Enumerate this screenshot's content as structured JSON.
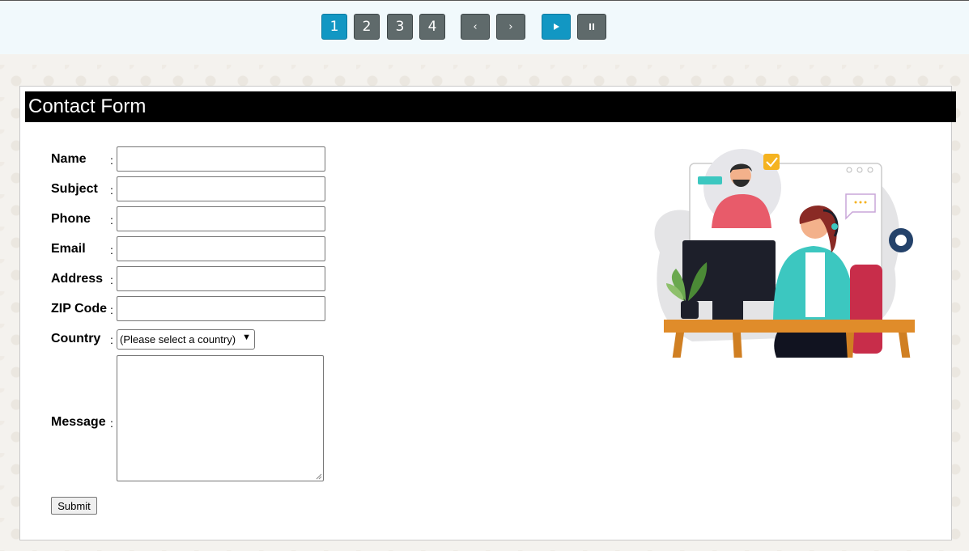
{
  "pagination": {
    "pages": [
      "1",
      "2",
      "3",
      "4"
    ],
    "active_page": "1",
    "prev_icon": "chevron-left-icon",
    "next_icon": "chevron-right-icon",
    "play_icon": "play-icon",
    "pause_icon": "pause-icon"
  },
  "form": {
    "title": "Contact Form",
    "fields": [
      {
        "label": "Name",
        "value": ""
      },
      {
        "label": "Subject",
        "value": ""
      },
      {
        "label": "Phone",
        "value": ""
      },
      {
        "label": "Email",
        "value": ""
      },
      {
        "label": "Address",
        "value": ""
      },
      {
        "label": "ZIP Code",
        "value": ""
      }
    ],
    "country_label": "Country",
    "country_selected": "(Please select a country)",
    "message_label": "Message",
    "colon": ":",
    "submit_label": "Submit"
  },
  "colors": {
    "header_bg": "#000000",
    "active_page": "#1297c3",
    "page_button": "#5f6a6b"
  }
}
